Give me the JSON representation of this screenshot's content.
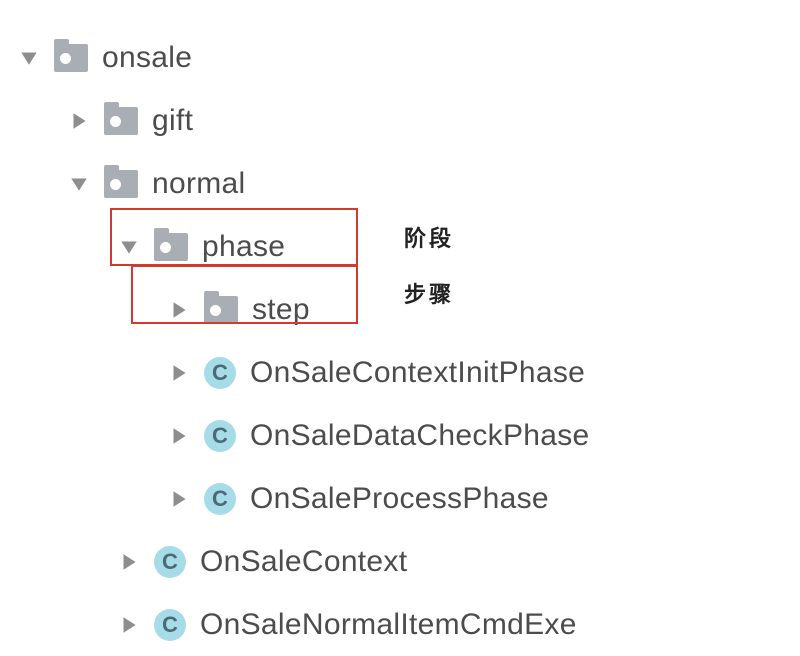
{
  "tree": {
    "onsale": "onsale",
    "gift": "gift",
    "normal": "normal",
    "phase": "phase",
    "step": "step",
    "cls_context_init": "OnSaleContextInitPhase",
    "cls_data_check": "OnSaleDataCheckPhase",
    "cls_process": "OnSaleProcessPhase",
    "cls_context": "OnSaleContext",
    "cls_cmd_exe": "OnSaleNormalItemCmdExe"
  },
  "icon_letters": {
    "class": "C"
  },
  "annotations": {
    "phase": "阶段",
    "step": "步骤"
  }
}
